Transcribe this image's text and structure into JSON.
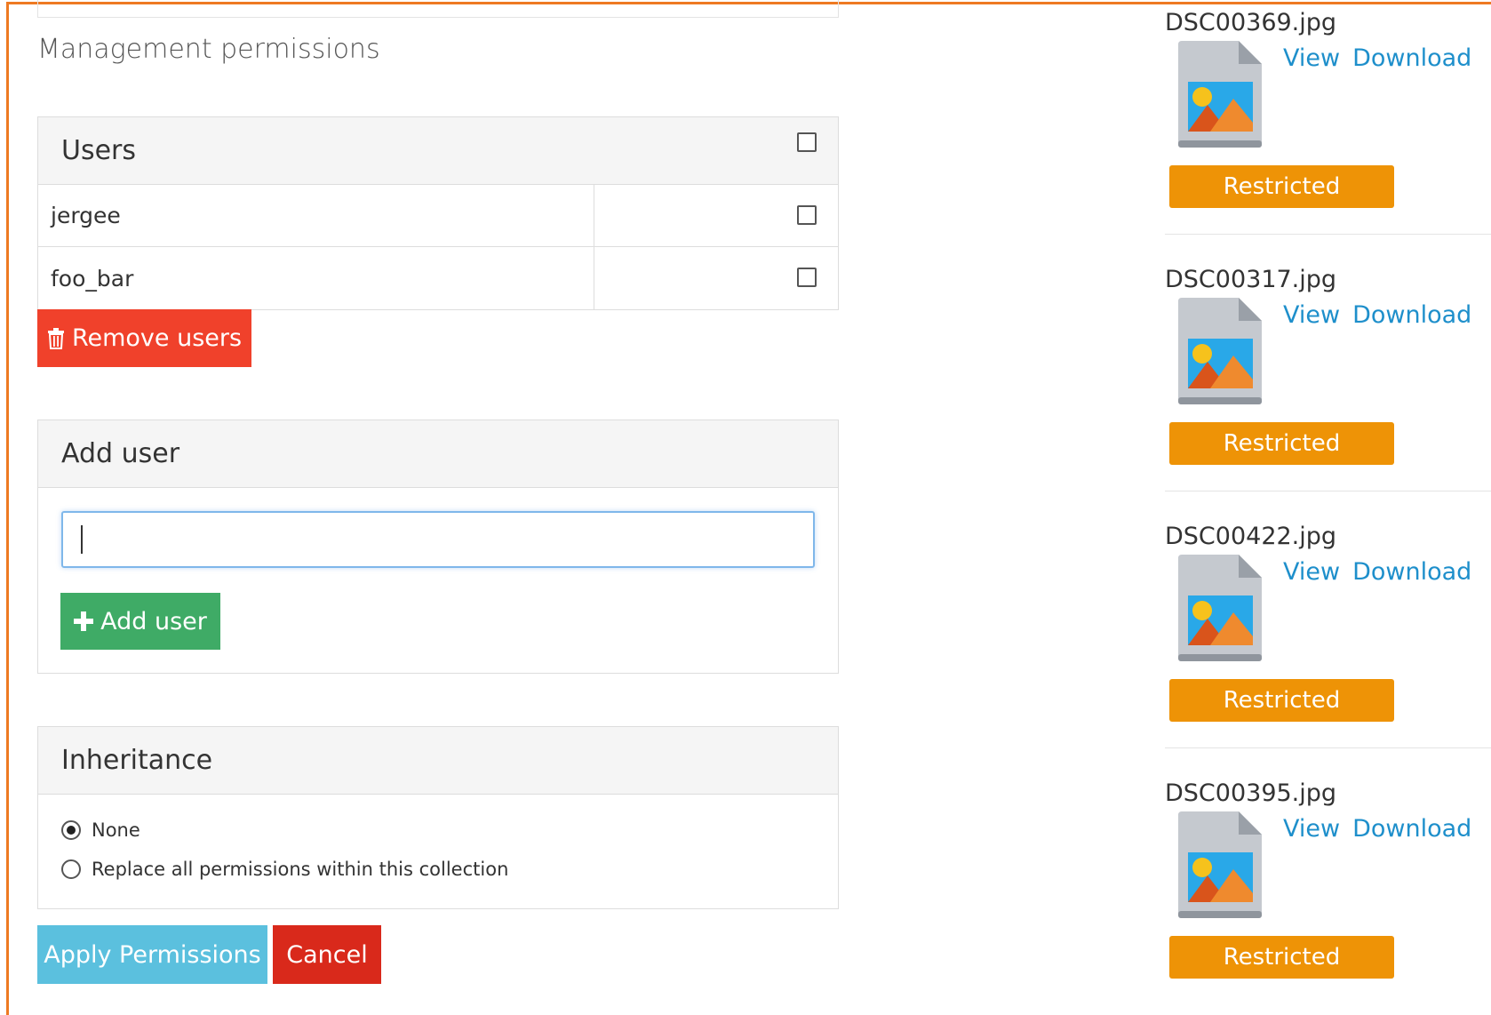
{
  "section_title": "Management permissions",
  "users_panel": {
    "title": "Users",
    "rows": [
      {
        "name": "jergee"
      },
      {
        "name": "foo_bar"
      }
    ],
    "remove_label": "Remove users"
  },
  "add_user_panel": {
    "title": "Add user",
    "input_value": "",
    "add_label": "Add user"
  },
  "inheritance_panel": {
    "title": "Inheritance",
    "options": [
      {
        "label": "None",
        "checked": true
      },
      {
        "label": "Replace all permissions within this collection",
        "checked": false
      }
    ]
  },
  "actions": {
    "apply_label": "Apply Permissions",
    "cancel_label": "Cancel"
  },
  "files": [
    {
      "name": "DSC00369.jpg",
      "view": "View",
      "download": "Download",
      "status": "Restricted"
    },
    {
      "name": "DSC00317.jpg",
      "view": "View",
      "download": "Download",
      "status": "Restricted"
    },
    {
      "name": "DSC00422.jpg",
      "view": "View",
      "download": "Download",
      "status": "Restricted"
    },
    {
      "name": "DSC00395.jpg",
      "view": "View",
      "download": "Download",
      "status": "Restricted"
    }
  ],
  "colors": {
    "accent_orange": "#ee7a22",
    "remove_red": "#f0412b",
    "add_green": "#3fab66",
    "apply_blue": "#5bc0de",
    "cancel_red": "#d9291b",
    "restricted_orange": "#ee9306",
    "link_blue": "#1e8fcb"
  }
}
